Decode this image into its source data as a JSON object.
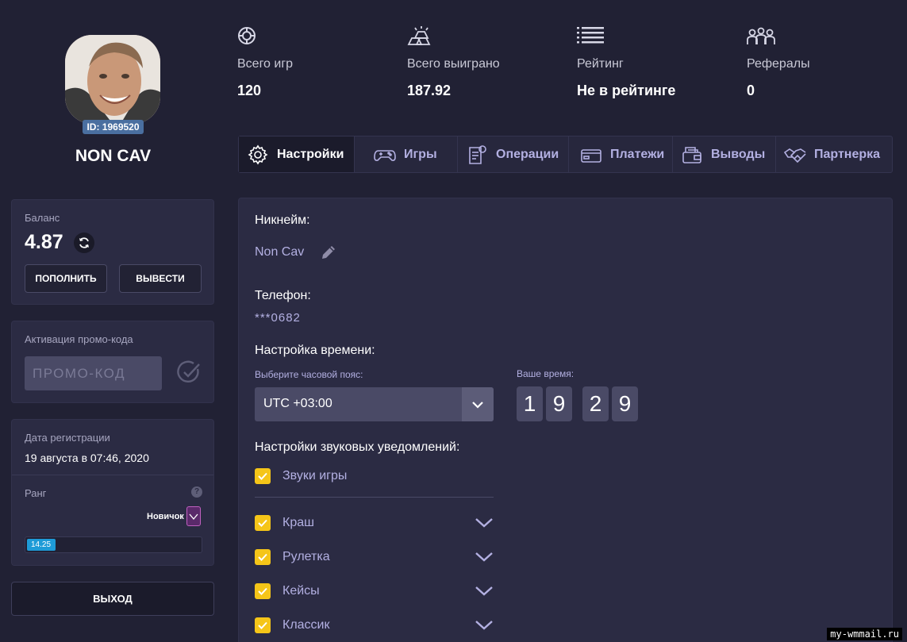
{
  "profile": {
    "id_badge": "ID: 1969520",
    "username": "NON CAV"
  },
  "stats": [
    {
      "icon": "chip-icon",
      "label": "Всего игр",
      "value": "120"
    },
    {
      "icon": "gold-bars-icon",
      "label": "Всего выиграно",
      "value": "187.92"
    },
    {
      "icon": "list-icon",
      "label": "Рейтинг",
      "value": "Не в рейтинге"
    },
    {
      "icon": "users-icon",
      "label": "Рефералы",
      "value": "0"
    }
  ],
  "tabs": [
    {
      "icon": "gear-icon",
      "label": "Настройки",
      "active": true
    },
    {
      "icon": "gamepad-icon",
      "label": "Игры",
      "active": false
    },
    {
      "icon": "receipt-icon",
      "label": "Операции",
      "active": false
    },
    {
      "icon": "wallet-icon",
      "label": "Платежи",
      "active": false
    },
    {
      "icon": "cash-out-icon",
      "label": "Выводы",
      "active": false
    },
    {
      "icon": "handshake-icon",
      "label": "Партнерка",
      "active": false
    }
  ],
  "balance": {
    "label": "Баланс",
    "value": "4.87",
    "deposit_label": "ПОПОЛНИТЬ",
    "withdraw_label": "ВЫВЕСТИ"
  },
  "promo": {
    "label": "Активация промо-кода",
    "placeholder": "ПРОМО-КОД"
  },
  "registration": {
    "label": "Дата регистрации",
    "date": "19 августа в 07:46, 2020"
  },
  "rank": {
    "label": "Ранг",
    "help": "?",
    "name": "Новичок",
    "progress_text": "14.25",
    "progress_fraction": 0.1425
  },
  "logout_label": "ВЫХОД",
  "settings": {
    "nickname_title": "Никнейм:",
    "nickname_value": "Non Cav",
    "phone_title": "Телефон:",
    "phone_value": "***0682",
    "time_title": "Настройка времени:",
    "tz_label": "Выберите часовой пояс:",
    "tz_value": "UTC +03:00",
    "your_time_label": "Ваше время:",
    "time_digits": [
      "1",
      "9",
      "2",
      "9"
    ],
    "sound_title": "Настройки звуковых уведомлений:",
    "sounds": [
      {
        "label": "Звуки игры",
        "checked": true,
        "expandable": false
      },
      {
        "label": "Краш",
        "checked": true,
        "expandable": true
      },
      {
        "label": "Рулетка",
        "checked": true,
        "expandable": true
      },
      {
        "label": "Кейсы",
        "checked": true,
        "expandable": true
      },
      {
        "label": "Классик",
        "checked": true,
        "expandable": true
      }
    ]
  },
  "colors": {
    "background": "#212134",
    "card": "#2b2b43",
    "accent_text": "#b3b0e2",
    "checkbox": "#f5c518",
    "progress": "#1e9bd7"
  },
  "watermark": "my-wmmail.ru"
}
